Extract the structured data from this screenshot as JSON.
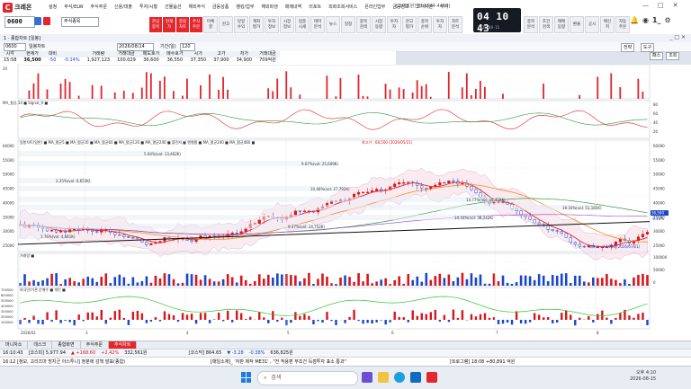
{
  "app": {
    "logo_text": "크레온",
    "menu": [
      "설정",
      "주식/ELW",
      "주식주문",
      "신용/대출",
      "투자/시황",
      "선물옵션",
      "해외주식",
      "금융상품",
      "뱅킹/업무",
      "해외파생",
      "매매내역",
      "리포트",
      "외화조회서비스",
      "온라인업무",
      "금융정보",
      "고객지원",
      "부가"
    ],
    "toplinks": "[고객지원센터 1544-4488]",
    "window_controls": [
      "—",
      "□",
      "✕"
    ]
  },
  "toolbar": {
    "account": "0600",
    "search_placeholder": "주식종목",
    "buttons_red": [
      "관심\n종목",
      "현재\n가",
      "종합\n차트",
      "주식\n주문"
    ],
    "buttons_gray": [
      "미체\n결",
      "잔고",
      "당일\n수익",
      "계좌\n평가",
      "투자\n정보",
      "시장\n정보",
      "업종\n시세",
      "테마\n분석",
      "뉴스",
      "일정",
      "종목\n검색",
      "시장\n동향",
      "투자\n자",
      "잔고\n평가",
      "종목\n순위",
      "투자\n자",
      "차트\n분석",
      "종목\n분석",
      "조건\n검색",
      "매매\n동향",
      "환율",
      "공시",
      "메신\n저",
      "자동\n주문"
    ],
    "clock_time": "04 10 43",
    "clock_date": "2026-08-15"
  },
  "chart_window": {
    "title": "1 · 종합차트 [일봉]",
    "code": "0600",
    "name": "일봉차트",
    "date": "2026/08/14",
    "period_label": "기간(일)",
    "period_value": "120",
    "right_controls": [
      "전략",
      "도구"
    ],
    "right_controls2": [
      "패스",
      "조회"
    ]
  },
  "quote": {
    "headers": [
      "시각",
      "현재가",
      "대비",
      "",
      "거래량",
      "거래대금",
      "매도호가",
      "매수호가",
      "시가",
      "고가",
      "저가",
      "거래대금"
    ],
    "values": [
      "15:58",
      "36,500",
      "-50",
      "-0.14%",
      "1,927,123",
      "100.029",
      "36,600",
      "36,550",
      "37,350",
      "37,900",
      "34,900",
      "709억원"
    ]
  },
  "panels": {
    "top_indicator_label": "",
    "macd_label": "MA_평균,14 ■ Signal_9 ■",
    "main_label": "일봉차트(일반) ■ MA_평균5 ■ MA_평균20 ■ MA_평균60 ■ MA_평균120 ■ MA_평균240 ■ 볼린저 ■ 엔벨롭 ■ MA_평균240 ■ MA_평균480 ■",
    "volume_label": "거래량 ■",
    "foreign_label": "외국인/기관 순매수 ■ 개인 ■",
    "annotations": [
      {
        "text": "최고가 : 68,500 (2026/05/21)",
        "color": "#d6171d"
      },
      {
        "text": "5.64%(vol: 13,462K)",
        "color": "#333"
      },
      {
        "text": "9.67%(vol: 25,609K)",
        "color": "#333"
      },
      {
        "text": "2.25%(vol: 6,655K)",
        "color": "#333"
      },
      {
        "text": "1.76%(vol: 4,681K)",
        "color": "#333"
      },
      {
        "text": "9.27%(vol: 24,752K)",
        "color": "#333"
      },
      {
        "text": "14.77%(vol: 39,459K)",
        "color": "#333"
      },
      {
        "text": "14.33%(vol: 38,242K)",
        "color": "#333"
      },
      {
        "text": "19.16%(vol: 51,185K)",
        "color": "#333"
      },
      {
        "text": "10.46%(vol: 27,792K)",
        "color": "#333"
      },
      {
        "text": "최저가 : 24,600 (2026/07/21)",
        "color": "#1a46c8"
      }
    ],
    "price_axis": [
      "60000",
      "55000",
      "50000",
      "45000",
      "40000",
      "35000",
      "30000",
      "25000"
    ],
    "price_current": "36,500",
    "price_change": "-0.14%",
    "macd_axis": [
      "20",
      "10",
      "0",
      "-10",
      "-20"
    ],
    "osc_axis": [
      "80",
      "60",
      "40",
      "20"
    ],
    "vol_axis": [
      "100000",
      "50000",
      "0"
    ],
    "foreign_axis": [
      "700000",
      "600000",
      "500000",
      "400000",
      "300000",
      "200000",
      "100000"
    ],
    "x_labels": [
      "2026/02",
      "3",
      "4",
      "5",
      "6",
      "7",
      "8"
    ]
  },
  "colors": {
    "up": "#d6171d",
    "down": "#1a46c8",
    "ma5": "#e3272d",
    "ma20": "#f08b25",
    "ma60": "#2d9a3f",
    "bb": "#9b3cc7"
  },
  "sheet_tabs": [
    "마니자소",
    "데스크",
    "종합화면",
    "주식주문",
    "주식차트"
  ],
  "ticker1": [
    "16:10:43",
    "[코스피] 5,977.94",
    "▲ +168.60",
    "+2.42%",
    "332,561원",
    "[코스닥] 864.65",
    "▼ -3.28",
    "-0.38%",
    "636,825원"
  ],
  "ticker2_left": "16:12 [정보, 고리즈마 방지군 아스투니] 정분에 감책 발표(종합)",
  "ticker2_mid": "[매일소재]_ '자판 제작 ME31' , \"전 적용편 무조건 득점투자 표소 통과\"",
  "ticker2_right": "[트로그램] 18:08 +80,891 억원",
  "taskbar": {
    "search_placeholder": "검색",
    "time": "오후 4:10",
    "date": "2026-08-15"
  }
}
